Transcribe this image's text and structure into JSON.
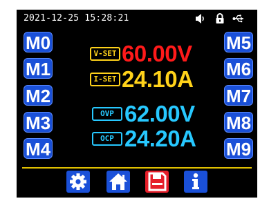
{
  "status_bar": {
    "datetime": "2021-12-25 15:28:21",
    "icons": [
      "speaker-icon",
      "lock-icon",
      "usb-icon"
    ]
  },
  "memory_buttons": {
    "left": [
      "M0",
      "M1",
      "M2",
      "M3",
      "M4"
    ],
    "right": [
      "M5",
      "M6",
      "M7",
      "M8",
      "M9"
    ]
  },
  "settings": {
    "vset": {
      "label": "V-SET",
      "value": "60.00V"
    },
    "iset": {
      "label": "I-SET",
      "value": "24.10A"
    },
    "ovp": {
      "label": "OVP",
      "value": "62.00V"
    },
    "ocp": {
      "label": "OCP",
      "value": "24.20A"
    }
  },
  "nav": {
    "items": [
      {
        "icon": "gear-icon",
        "color": "#1a50d8"
      },
      {
        "icon": "home-icon",
        "color": "#1a50d8"
      },
      {
        "icon": "save-icon",
        "color": "#e61e2a",
        "active": true
      },
      {
        "icon": "info-icon",
        "color": "#1a50d8"
      }
    ]
  },
  "colors": {
    "vset_value": "#ff1a1a",
    "iset_value": "#ffd21a",
    "protect_value": "#27c8ff",
    "tag_yellow": "#ffd21a",
    "tag_cyan": "#27c8ff",
    "divider": "#e0c000",
    "button_blue": "#1a50d8",
    "button_red": "#e61e2a"
  }
}
